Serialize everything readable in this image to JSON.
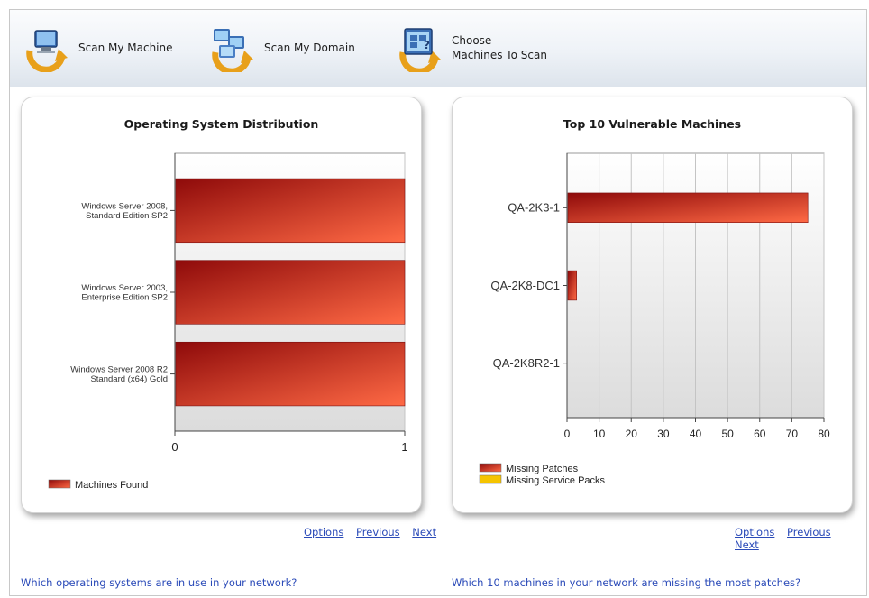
{
  "toolbar": {
    "scan_machine": "Scan My Machine",
    "scan_domain": "Scan My Domain",
    "choose_line1": "Choose",
    "choose_line2": "Machines To Scan"
  },
  "left_panel": {
    "options": "Options",
    "previous": "Previous",
    "next": "Next",
    "question": "Which operating systems are in use in your network?"
  },
  "right_panel": {
    "options": "Options",
    "previous": "Previous",
    "next": "Next",
    "question": "Which 10 machines in your network are missing the most patches?"
  },
  "colors": {
    "bar_dark": "#8e0a0a",
    "bar_light": "#ff6a45",
    "service_pack": "#f5c400",
    "link": "#2a4ab8"
  },
  "chart_data": [
    {
      "type": "bar",
      "orientation": "horizontal",
      "title": "Operating System Distribution",
      "categories": [
        [
          "Windows Server 2008,",
          "Standard Edition SP2"
        ],
        [
          "Windows Server 2003,",
          "Enterprise Edition SP2"
        ],
        [
          "Windows Server 2008 R2",
          "Standard (x64) Gold"
        ]
      ],
      "series": [
        {
          "name": "Machines Found",
          "values": [
            1,
            1,
            1
          ]
        }
      ],
      "xlim": [
        0,
        1
      ],
      "xticks": [
        "0",
        "1"
      ],
      "grid": true,
      "legend": "bottom-left"
    },
    {
      "type": "bar",
      "orientation": "horizontal",
      "title": "Top 10 Vulnerable Machines",
      "categories": [
        "QA-2K3-1",
        "QA-2K8-DC1",
        "QA-2K8R2-1"
      ],
      "series": [
        {
          "name": "Missing Patches",
          "values": [
            75,
            3,
            0
          ]
        },
        {
          "name": "Missing Service Packs",
          "values": [
            0,
            0,
            0
          ]
        }
      ],
      "xlim": [
        0,
        80
      ],
      "xticks": [
        "0",
        "10",
        "20",
        "30",
        "40",
        "50",
        "60",
        "70",
        "80"
      ],
      "grid": true,
      "legend": "bottom-left"
    }
  ]
}
